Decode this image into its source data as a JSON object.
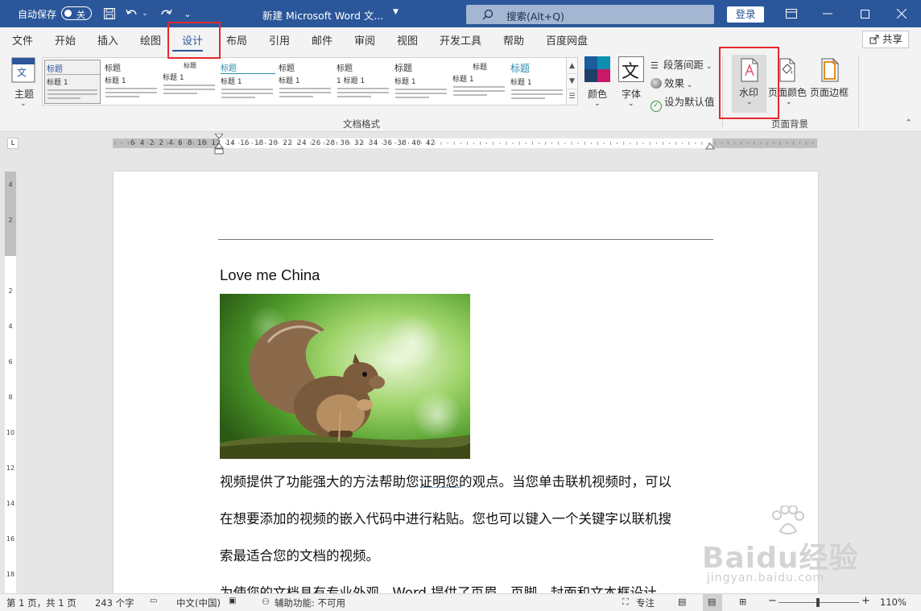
{
  "titlebar": {
    "autosave_label": "自动保存",
    "autosave_state": "关",
    "doc_title": "新建 Microsoft Word 文...",
    "search_placeholder": "搜索(Alt+Q)",
    "login_label": "登录"
  },
  "tabs": [
    {
      "label": "文件",
      "active": false
    },
    {
      "label": "开始",
      "active": false
    },
    {
      "label": "插入",
      "active": false
    },
    {
      "label": "绘图",
      "active": false
    },
    {
      "label": "设计",
      "active": true
    },
    {
      "label": "布局",
      "active": false
    },
    {
      "label": "引用",
      "active": false
    },
    {
      "label": "邮件",
      "active": false
    },
    {
      "label": "审阅",
      "active": false
    },
    {
      "label": "视图",
      "active": false
    },
    {
      "label": "开发工具",
      "active": false
    },
    {
      "label": "帮助",
      "active": false
    },
    {
      "label": "百度网盘",
      "active": false
    }
  ],
  "share_label": "共享",
  "ribbon": {
    "theme_label": "主题",
    "styles_group_label": "文档格式",
    "style_thumbs": [
      {
        "title": "标题",
        "sub": "标题 1"
      },
      {
        "title": "标题",
        "sub": "标题 1"
      },
      {
        "title": "标题",
        "sub": "标题 1"
      },
      {
        "title": "标题",
        "sub": "标题 1"
      },
      {
        "title": "标题",
        "sub": "标题 1"
      },
      {
        "title": "标题",
        "sub": "1 标题 1"
      },
      {
        "title": "标题",
        "sub": "标题 1"
      },
      {
        "title": "标题",
        "sub": "标题 1"
      },
      {
        "title": "标题",
        "sub": "标题 1"
      }
    ],
    "colors_label": "颜色",
    "fonts_label": "字体",
    "paragraph_spacing_label": "段落间距",
    "effects_label": "效果",
    "set_default_label": "设为默认值",
    "watermark_label": "水印",
    "page_color_label": "页面颜色",
    "page_border_label": "页面边框",
    "page_bg_group_label": "页面背景"
  },
  "ruler": {
    "h_marks": "6  4  2    2  4  6  8  10  12  14  16  18  20  22  24  26  28  30  32  34  36  38  40  42",
    "v_marks": [
      "4",
      "2",
      "",
      "2",
      "4",
      "6",
      "8",
      "10",
      "12",
      "14",
      "16",
      "18"
    ]
  },
  "document": {
    "heading": "Love me China",
    "para1": "视频提供了功能强大的方法帮助您证明您的观点。当您单击联机视频时，可以",
    "para2": "在想要添加的视频的嵌入代码中进行粘贴。您也可以键入一个关键字以联机搜",
    "para3": "索最适合您的文档的视频。",
    "para4": "为使您的文档具有专业外观，Word 提供了页眉、页脚、封面和文本框设计，"
  },
  "statusbar": {
    "page": "第 1 页，共 1 页",
    "words": "243 个字",
    "lang": "中文(中国)",
    "accessibility": "辅助功能: 不可用",
    "focus": "专注",
    "zoom": "110%"
  },
  "watermark_text": "Baidu经验",
  "watermark_url": "jingyan.baidu.com",
  "colors": {
    "brand": "#2b579a",
    "highlight": "#e8272b"
  }
}
